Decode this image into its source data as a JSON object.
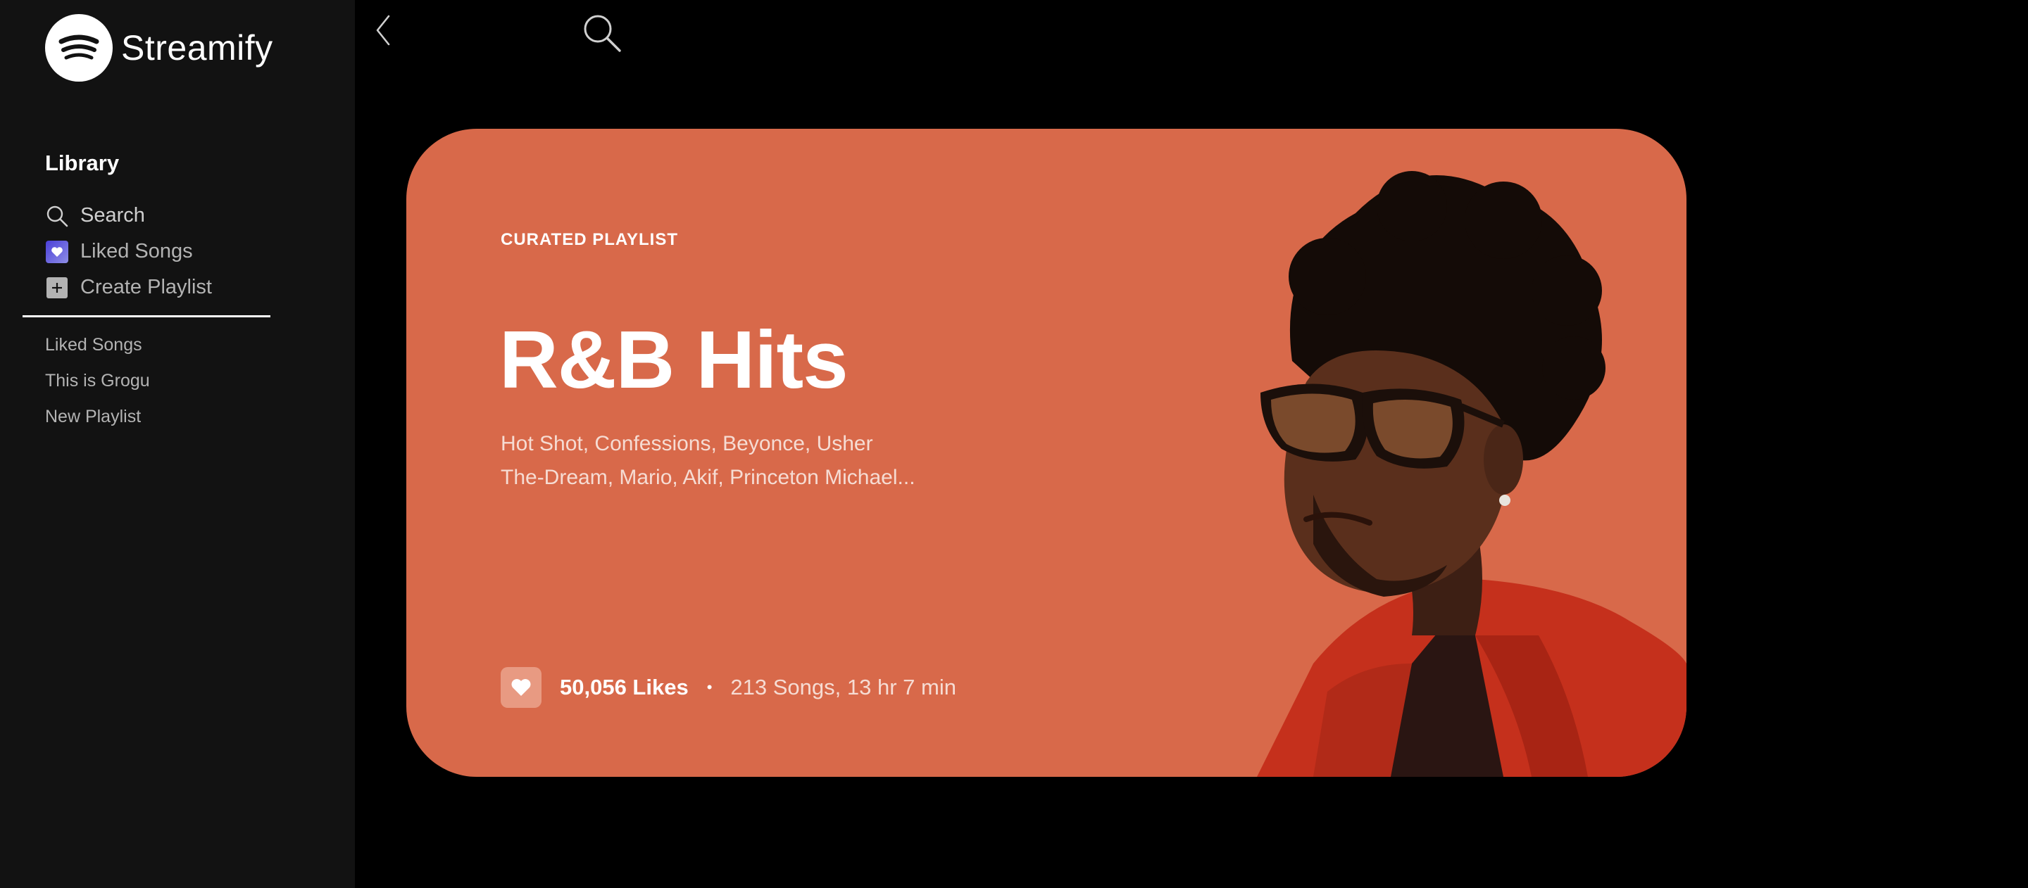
{
  "app": {
    "name": "Streamify"
  },
  "sidebar": {
    "heading": "Library",
    "nav": [
      {
        "label": "Search",
        "icon": "search-icon"
      },
      {
        "label": "Liked Songs",
        "icon": "heart-icon"
      },
      {
        "label": "Create Playlist",
        "icon": "plus-icon"
      }
    ],
    "playlists": [
      {
        "label": "Liked Songs"
      },
      {
        "label": "This is Grogu"
      },
      {
        "label": "New Playlist"
      }
    ]
  },
  "topbar": {
    "back_icon": "chevron-left-icon",
    "search_icon": "search-icon"
  },
  "hero": {
    "label": "CURATED PLAYLIST",
    "title": "R&B Hits",
    "description_lines": [
      "Hot Shot, Confessions, Beyonce, Usher",
      "The-Dream, Mario, Akif, Princeton Michael..."
    ],
    "likes": "50,056 Likes",
    "separator": "•",
    "info": "213 Songs, 13 hr 7 min",
    "like_icon": "heart-icon"
  },
  "colors": {
    "sidebar_bg": "#121212",
    "main_bg": "#000000",
    "hero_bg": "#d8694a",
    "muted_text": "#b3b3b3",
    "liked_gradient_start": "#4a3fd8",
    "liked_gradient_end": "#8e8ee6"
  }
}
